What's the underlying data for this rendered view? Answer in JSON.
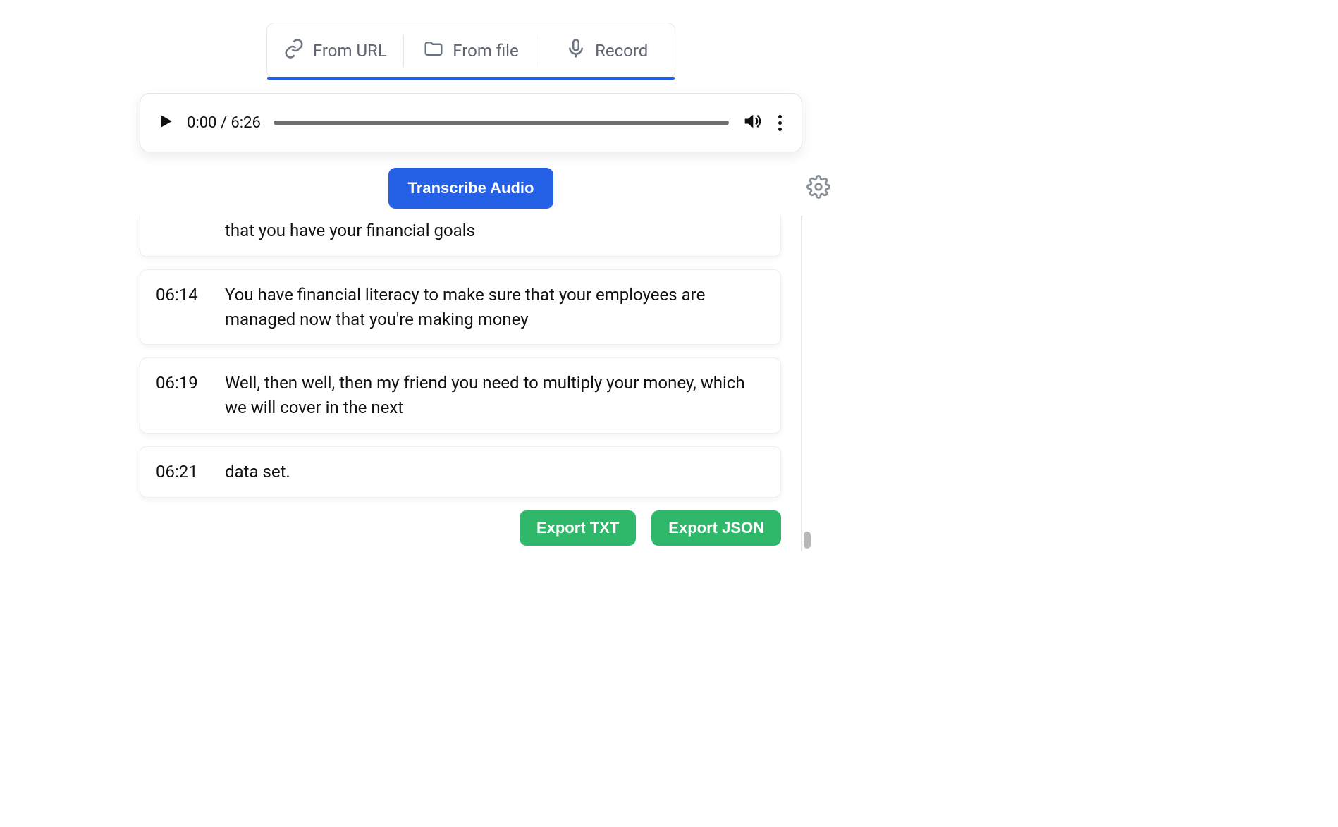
{
  "tabs": {
    "from_url": "From URL",
    "from_file": "From file",
    "record": "Record"
  },
  "player": {
    "current_time": "0:00",
    "duration": "6:26",
    "separator": " / "
  },
  "actions": {
    "transcribe": "Transcribe Audio",
    "export_txt": "Export TXT",
    "export_json": "Export JSON"
  },
  "transcript": {
    "partial_text": "that you have your financial goals",
    "segments": [
      {
        "time": "06:14",
        "text": "You have financial literacy to make sure that your employees are managed now that you're making money"
      },
      {
        "time": "06:19",
        "text": "Well, then well, then my friend you need to multiply your money, which we will cover in the next"
      },
      {
        "time": "06:21",
        "text": "data set."
      }
    ]
  }
}
